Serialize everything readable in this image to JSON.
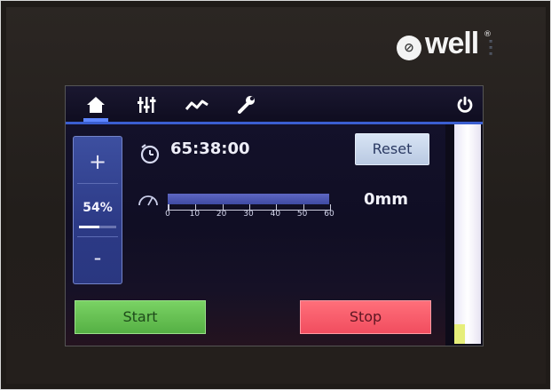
{
  "brand": {
    "name": "well",
    "registered": "®"
  },
  "tabs": [
    {
      "id": "home",
      "icon": "home-icon",
      "active": true
    },
    {
      "id": "settings",
      "icon": "equalizer-icon",
      "active": false
    },
    {
      "id": "graph",
      "icon": "graph-icon",
      "active": false
    },
    {
      "id": "tools",
      "icon": "wrench-icon",
      "active": false
    }
  ],
  "power_icon": "power-icon",
  "speed": {
    "plus_label": "+",
    "minus_label": "-",
    "value_label": "54%",
    "level": 0.54
  },
  "timer": {
    "icon": "timer-icon",
    "value": "65:38:00"
  },
  "reset_label": "Reset",
  "depth": {
    "icon": "gauge-icon",
    "scale_labels": [
      "0",
      "10",
      "20",
      "30",
      "40",
      "50",
      "60"
    ],
    "scale_min": 0,
    "scale_max": 60,
    "current": 0,
    "value_label": "0mm"
  },
  "actions": {
    "start_label": "Start",
    "stop_label": "Stop"
  },
  "colors": {
    "accent": "#3a5ed0",
    "start": "#5fbf4e",
    "stop": "#f45a68",
    "panel": "#2f3d8a"
  }
}
